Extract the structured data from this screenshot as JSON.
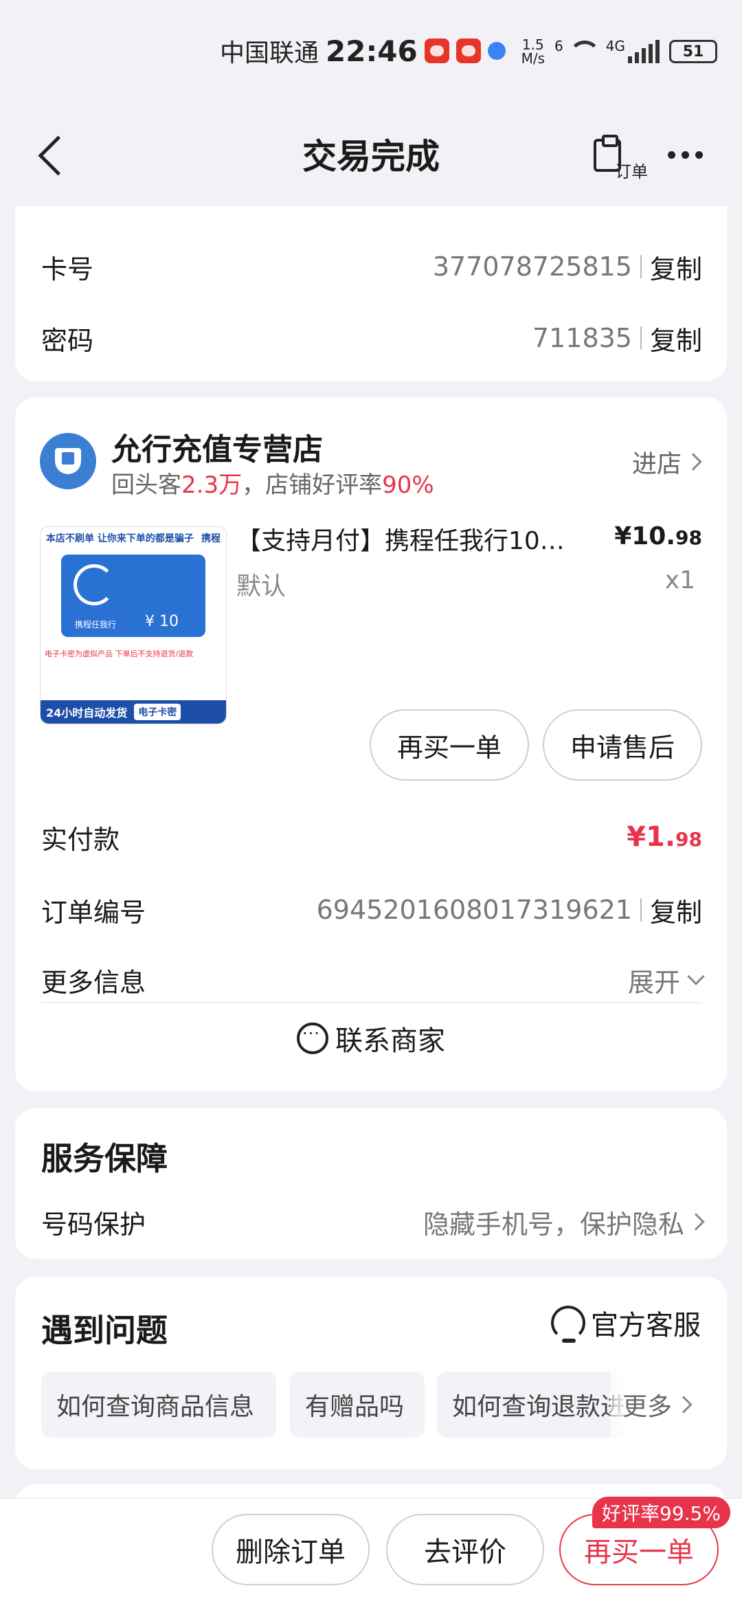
{
  "status_bar": {
    "carrier": "中国联通",
    "time": "22:46",
    "net_speed_top": "1.5",
    "net_speed_bottom": "M/s",
    "wifi_label": "6",
    "signal_label": "4G",
    "battery": "51"
  },
  "nav": {
    "title": "交易完成",
    "order_label": "订单"
  },
  "card_info": {
    "card_number_label": "卡号",
    "card_number": "377078725815",
    "password_label": "密码",
    "password": "711835",
    "copy": "复制"
  },
  "store": {
    "name": "允行充值专营店",
    "returning_prefix": "回头客",
    "returning_value": "2.3万",
    "rating_prefix": "，店铺好评率",
    "rating_value": "90%",
    "enter": "进店"
  },
  "product": {
    "title": "【支持月付】携程任我行10…",
    "price_main": "¥10.",
    "price_decimal": "98",
    "spec": "默认",
    "qty": "x1",
    "image_banner": "本店不刷单 让你来下单的都是骗子",
    "image_brand": "携程",
    "image_card_text": "携程任我行",
    "image_card_amount": "¥ 10",
    "image_note": "电子卡密为虚拟产品 下单后不支持退货/退款",
    "image_band": "24小时自动发货",
    "image_tag": "电子卡密"
  },
  "actions": {
    "buy_again": "再买一单",
    "after_sale": "申请售后"
  },
  "order": {
    "paid_label": "实付款",
    "paid_main": "¥1.",
    "paid_decimal": "98",
    "order_no_label": "订单编号",
    "order_no": "6945201608017319621",
    "copy": "复制",
    "more_label": "更多信息",
    "expand": "展开",
    "contact": "联系商家"
  },
  "service": {
    "title": "服务保障",
    "item_label": "号码保护",
    "item_value": "隐藏手机号，保护隐私"
  },
  "problems": {
    "title": "遇到问题",
    "official_service": "官方客服",
    "chips": [
      "如何查询商品信息",
      "有赠品吗",
      "如何查询退款进度"
    ],
    "more": "更多"
  },
  "bottom_bar": {
    "delete": "删除订单",
    "review": "去评价",
    "buy_again": "再买一单",
    "badge": "好评率99.5%"
  },
  "colors": {
    "accent_red": "#e8344b",
    "brand_blue": "#3a7fd1"
  }
}
